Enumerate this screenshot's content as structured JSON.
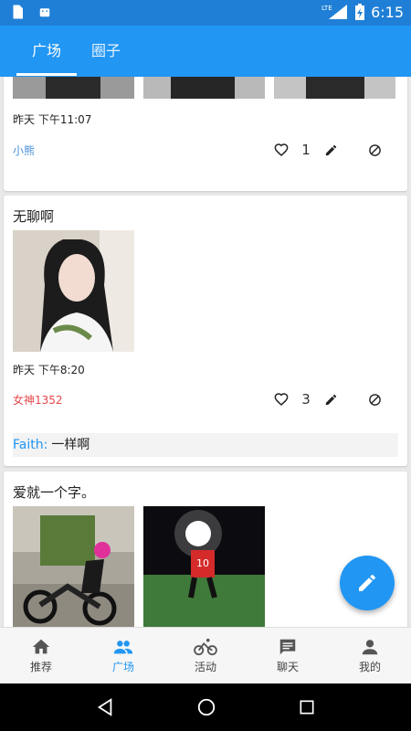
{
  "status": {
    "network": "LTE",
    "time": "6:15"
  },
  "tabs": [
    {
      "label": "广场"
    },
    {
      "label": "圈子"
    }
  ],
  "posts": [
    {
      "time": "昨天 下午11:07",
      "author": "小熊",
      "author_color": "#4a90d9",
      "likes": "1"
    },
    {
      "title": "无聊啊",
      "time": "昨天 下午8:20",
      "author": "女神1352",
      "author_color": "#e5484d",
      "likes": "3",
      "comment": {
        "name": "Faith:",
        "text": "一样啊"
      }
    },
    {
      "title": "爱就一个字。"
    }
  ],
  "bottom_nav": [
    {
      "label": "推荐",
      "icon": "home-icon"
    },
    {
      "label": "广场",
      "icon": "people-icon"
    },
    {
      "label": "活动",
      "icon": "bike-icon"
    },
    {
      "label": "聊天",
      "icon": "chat-icon"
    },
    {
      "label": "我的",
      "icon": "person-icon"
    }
  ],
  "colors": {
    "primary": "#2196f3",
    "status_bar": "#1f7fd6"
  }
}
